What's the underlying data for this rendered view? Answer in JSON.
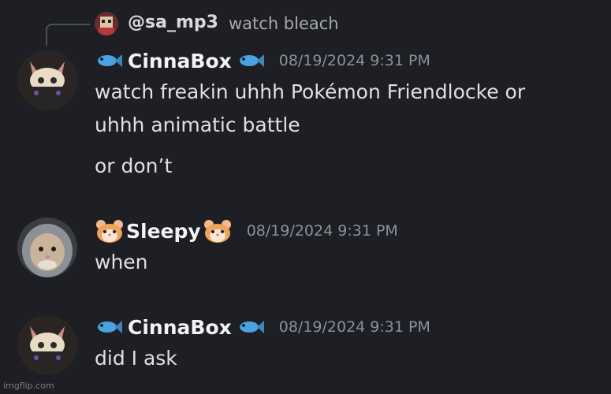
{
  "reply": {
    "username": "@sa_mp3",
    "text": "watch bleach"
  },
  "messages": [
    {
      "username": "CinnaBox",
      "timestamp": "08/19/2024 9:31 PM",
      "lines": [
        "watch freakin uhhh Pokémon Friendlocke or",
        "uhhh animatic battle",
        "or don’t"
      ],
      "avatar": "cat-mask-avatar"
    },
    {
      "username": "Sleepy",
      "timestamp": "08/19/2024 9:31 PM",
      "lines": [
        "when"
      ],
      "avatar": "hamster-hoodie-avatar"
    },
    {
      "username": "CinnaBox",
      "timestamp": "08/19/2024 9:31 PM",
      "lines": [
        "did I ask"
      ],
      "avatar": "cat-mask-avatar"
    }
  ],
  "watermark": "imgflip.com",
  "colors": {
    "background": "#1e1f24",
    "username": "#f2f3f5",
    "timestamp": "#8e9099",
    "message_text": "#dfe0e3",
    "fish_blue": "#4aa3df",
    "hamster_orange": "#f0a35e"
  }
}
